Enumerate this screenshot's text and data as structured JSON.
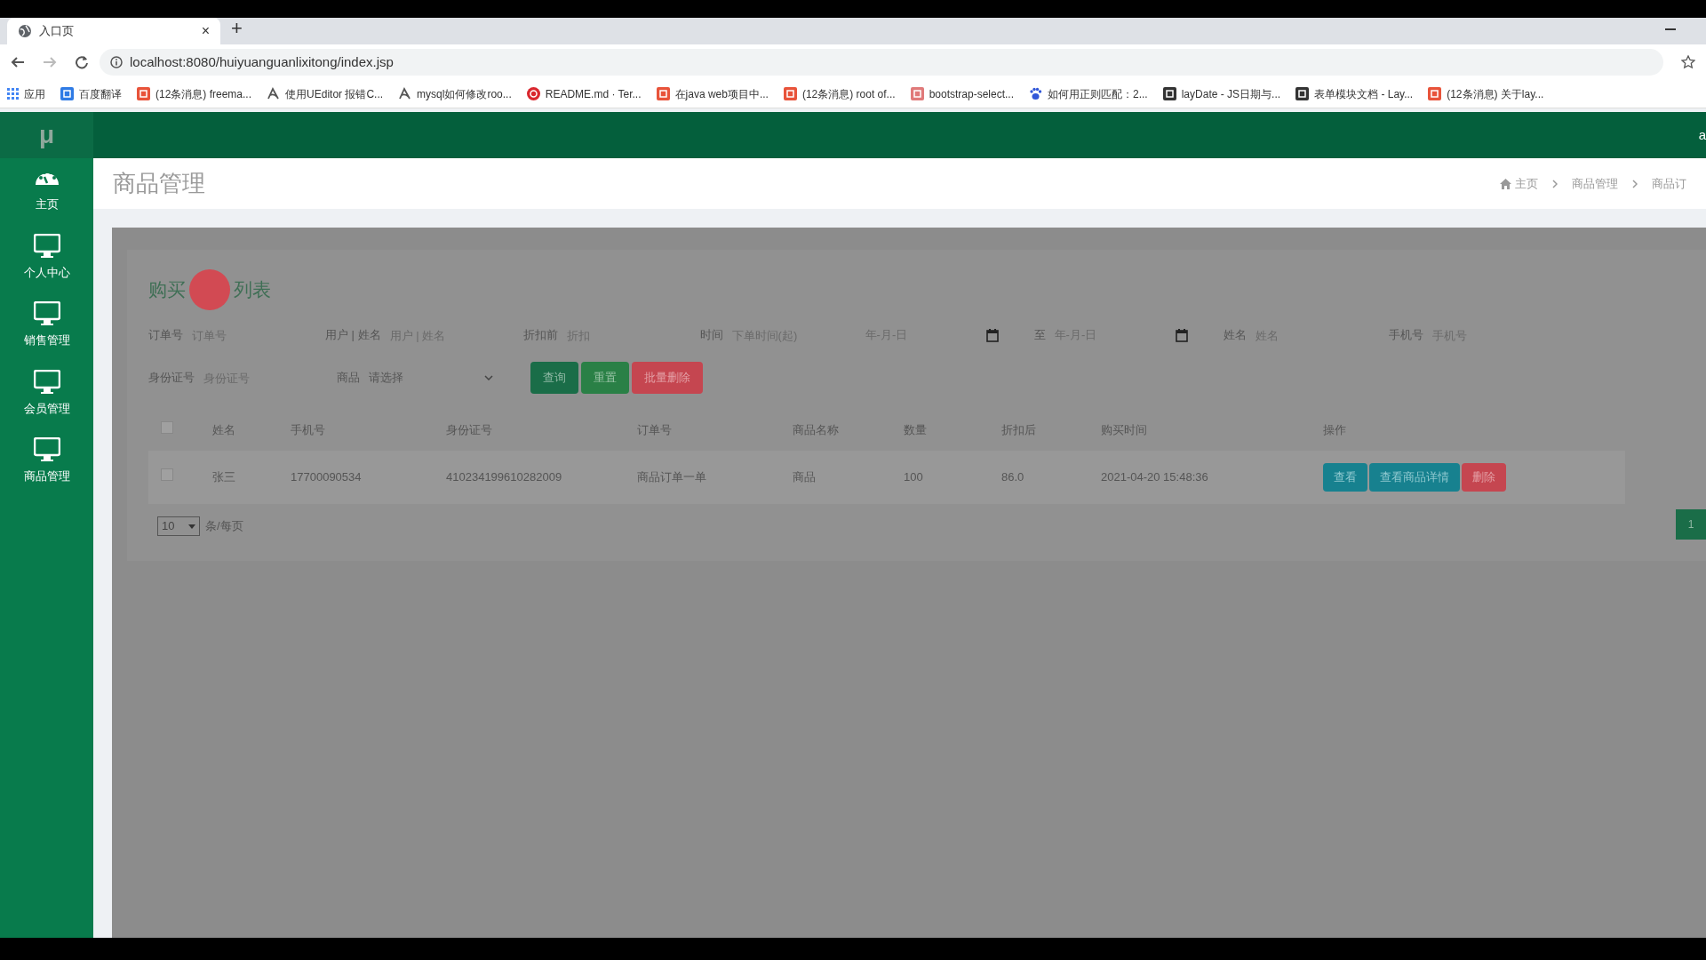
{
  "browser": {
    "tab_title": "入口页",
    "tab_close": "×",
    "new_tab": "+",
    "url": "localhost:8080/huiyuanguanlixitong/index.jsp",
    "bookmarks": [
      {
        "label": "应用",
        "kind": "apps",
        "color": "#4285f4"
      },
      {
        "label": "百度翻译",
        "kind": "square",
        "color": "#2f7be5"
      },
      {
        "label": "(12条消息) freema...",
        "kind": "square",
        "color": "#e8533a"
      },
      {
        "label": "使用UEditor 报错C...",
        "kind": "glyph",
        "color": "#555555"
      },
      {
        "label": "mysql如何修改roo...",
        "kind": "glyph",
        "color": "#555555"
      },
      {
        "label": "README.md · Ter...",
        "kind": "circle",
        "color": "#d9272e"
      },
      {
        "label": "在java web项目中...",
        "kind": "square",
        "color": "#e8533a"
      },
      {
        "label": "(12条消息) root of...",
        "kind": "square",
        "color": "#e8533a"
      },
      {
        "label": "bootstrap-select...",
        "kind": "square",
        "color": "#e07a7a"
      },
      {
        "label": "如何用正则匹配：2...",
        "kind": "paw",
        "color": "#3157d8"
      },
      {
        "label": "layDate - JS日期与...",
        "kind": "square",
        "color": "#333333"
      },
      {
        "label": "表单模块文档 - Lay...",
        "kind": "square",
        "color": "#333333"
      },
      {
        "label": "(12条消息) 关于lay...",
        "kind": "square",
        "color": "#e8533a"
      }
    ]
  },
  "app": {
    "logo": "μ",
    "user": "a",
    "sidebar": [
      {
        "label": "主页",
        "kind": "dashboard"
      },
      {
        "label": "个人中心",
        "kind": "monitor"
      },
      {
        "label": "销售管理",
        "kind": "monitor"
      },
      {
        "label": "会员管理",
        "kind": "monitor"
      },
      {
        "label": "商品管理",
        "kind": "monitor"
      }
    ],
    "page_title": "商品管理",
    "breadcrumb": [
      "主页",
      "商品管理",
      "商品订"
    ],
    "panel": {
      "title_parts": [
        "购买",
        "列表"
      ],
      "select_all_checked": false,
      "filters_row_1": [
        {
          "label": "订单号",
          "placeholder": "订单号",
          "kind": "text"
        },
        {
          "label": "用户 | 姓名",
          "placeholder": "用户 | 姓名",
          "kind": "text"
        },
        {
          "label": "折扣前",
          "placeholder": "折扣",
          "kind": "text"
        },
        {
          "label": "时间",
          "placeholder": "下单时间(起)",
          "kind": "text"
        },
        {
          "placeholder": "年-月-日",
          "kind": "date"
        },
        {
          "label": "至",
          "placeholder": "年-月-日",
          "kind": "date"
        },
        {
          "label": "姓名",
          "placeholder": "姓名",
          "kind": "text"
        },
        {
          "label": "手机号",
          "placeholder": "手机号",
          "kind": "text"
        }
      ],
      "filters_row_2": [
        {
          "label": "身份证号",
          "placeholder": "身份证号",
          "kind": "text"
        },
        {
          "label": "商品",
          "value": "请选择",
          "kind": "select"
        }
      ],
      "buttons": [
        {
          "label": "查询",
          "kind": "primary"
        },
        {
          "label": "重置",
          "kind": "success"
        },
        {
          "label": "批量删除",
          "kind": "danger"
        }
      ],
      "columns": [
        "姓名",
        "手机号",
        "身份证号",
        "订单号",
        "商品名称",
        "数量",
        "折扣后",
        "购买时间",
        "操作"
      ],
      "rows": [
        {
          "checked": false,
          "cells": [
            "张三",
            "17700090534",
            "410234199610282009",
            "商品订单一单",
            "商品",
            "100",
            "86.0",
            "2021-04-20 15:48:36"
          ],
          "actions": [
            {
              "label": "查看",
              "kind": "info"
            },
            {
              "label": "查看商品详情",
              "kind": "info"
            },
            {
              "label": "删除",
              "kind": "danger"
            }
          ]
        }
      ],
      "page_size": "10",
      "page_size_label": "条/每页",
      "page": "1"
    }
  }
}
